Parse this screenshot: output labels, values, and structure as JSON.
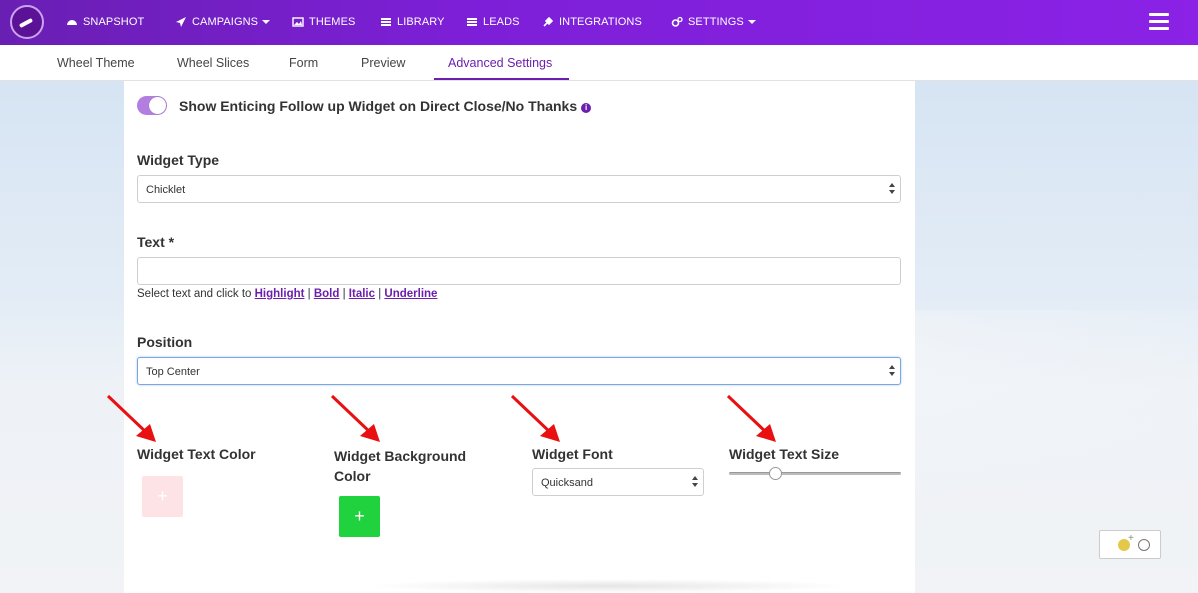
{
  "nav": {
    "items": [
      {
        "label": "SNAPSHOT",
        "icon": "dashboard-icon"
      },
      {
        "label": "CAMPAIGNS",
        "icon": "paper-plane-icon",
        "dropdown": true
      },
      {
        "label": "THEMES",
        "icon": "image-icon"
      },
      {
        "label": "LIBRARY",
        "icon": "list-icon"
      },
      {
        "label": "LEADS",
        "icon": "list-icon"
      },
      {
        "label": "INTEGRATIONS",
        "icon": "plug-icon"
      },
      {
        "label": "SETTINGS",
        "icon": "gears-icon",
        "dropdown": true
      }
    ]
  },
  "tabs": [
    {
      "label": "Wheel Theme"
    },
    {
      "label": "Wheel Slices"
    },
    {
      "label": "Form"
    },
    {
      "label": "Preview"
    },
    {
      "label": "Advanced Settings",
      "active": true
    }
  ],
  "form": {
    "toggle_label": "Show Enticing Follow up Widget on Direct Close/No Thanks",
    "widget_type_label": "Widget Type",
    "widget_type_value": "Chicklet",
    "text_label": "Text *",
    "text_value": "",
    "help_prefix": "Select text and click to",
    "help_links": [
      "Highlight",
      "Bold",
      "Italic",
      "Underline"
    ],
    "position_label": "Position",
    "position_value": "Top Center",
    "text_color_label": "Widget Text Color",
    "bg_color_label": "Widget Background Color",
    "font_label": "Widget Font",
    "font_value": "Quicksand",
    "size_label": "Widget Text Size",
    "text_size_level": 0.27
  },
  "colors": {
    "accent": "#6c1fae",
    "nav_bg": "#7d1fd8",
    "text_color_swatch": "#fde3e6",
    "bg_color_swatch": "#1fd23e",
    "arrow": "#e81010"
  },
  "plus_glyph": "+"
}
